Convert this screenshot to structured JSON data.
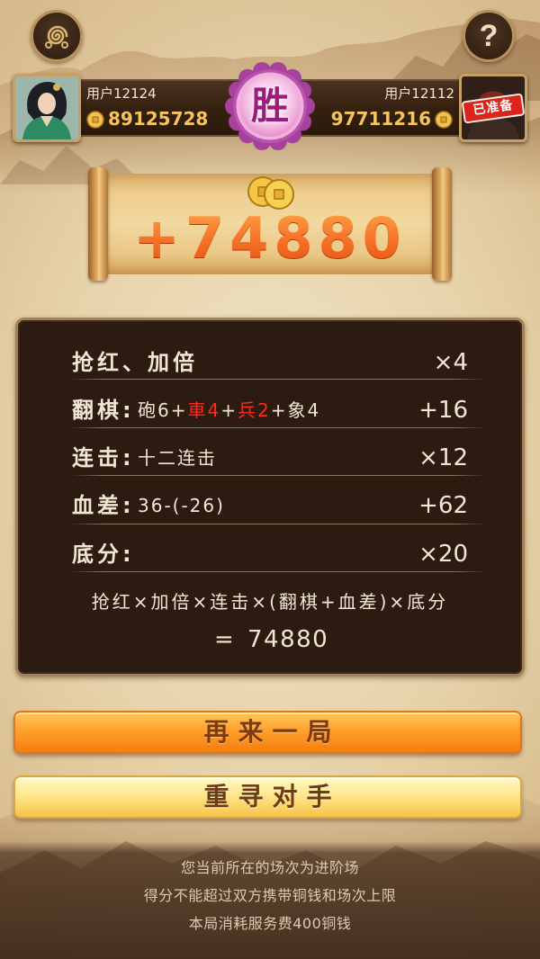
{
  "top_bar": {
    "menu_button": {
      "icon": "cloud-swirl-icon"
    },
    "help_button": {
      "icon": "question-mark-icon",
      "glyph": "?"
    }
  },
  "players": {
    "left": {
      "name": "用户12124",
      "coins": "89125728",
      "coin_icon": "copper-coin-icon"
    },
    "right": {
      "name": "用户12112",
      "coins": "97711216",
      "coin_icon": "copper-coin-icon",
      "status_stamp": "已准备"
    }
  },
  "result": {
    "badge": "胜",
    "reward_icon": "coin-pair-icon",
    "reward": "+74880"
  },
  "breakdown": {
    "rows": [
      {
        "label": "抢红、加倍",
        "value": "×4"
      },
      {
        "label": "翻棋:",
        "detail_parts": [
          {
            "text": "砲6+",
            "highlight": false
          },
          {
            "text": "車4",
            "highlight": true
          },
          {
            "text": "+",
            "highlight": false
          },
          {
            "text": "兵2",
            "highlight": true
          },
          {
            "text": "+象4",
            "highlight": false
          }
        ],
        "value": "+16"
      },
      {
        "label": "连击:",
        "detail": "十二连击",
        "value": "×12"
      },
      {
        "label": "血差:",
        "detail": "36-(-26)",
        "value": "+62"
      },
      {
        "label": "底分:",
        "value": "×20"
      }
    ],
    "formula": "抢红×加倍×连击×(翻棋+血差)×底分",
    "equals": "=",
    "total": "74880"
  },
  "buttons": {
    "play_again": "再来一局",
    "find_new_opponent": "重寻对手"
  },
  "footer": {
    "lines": [
      "您当前所在的场次为进阶场",
      "得分不能超过双方携带铜钱和场次上限",
      "本局消耗服务费400铜钱"
    ]
  },
  "colors": {
    "coin_gold": "#f6c45c",
    "reward_orange": "#f46a1e",
    "highlight_red": "#ff2a1a",
    "victory_badge_pink": "#c44fb3",
    "play_again_orange": "#f8961e",
    "find_opponent_yellow": "#fde17a"
  }
}
